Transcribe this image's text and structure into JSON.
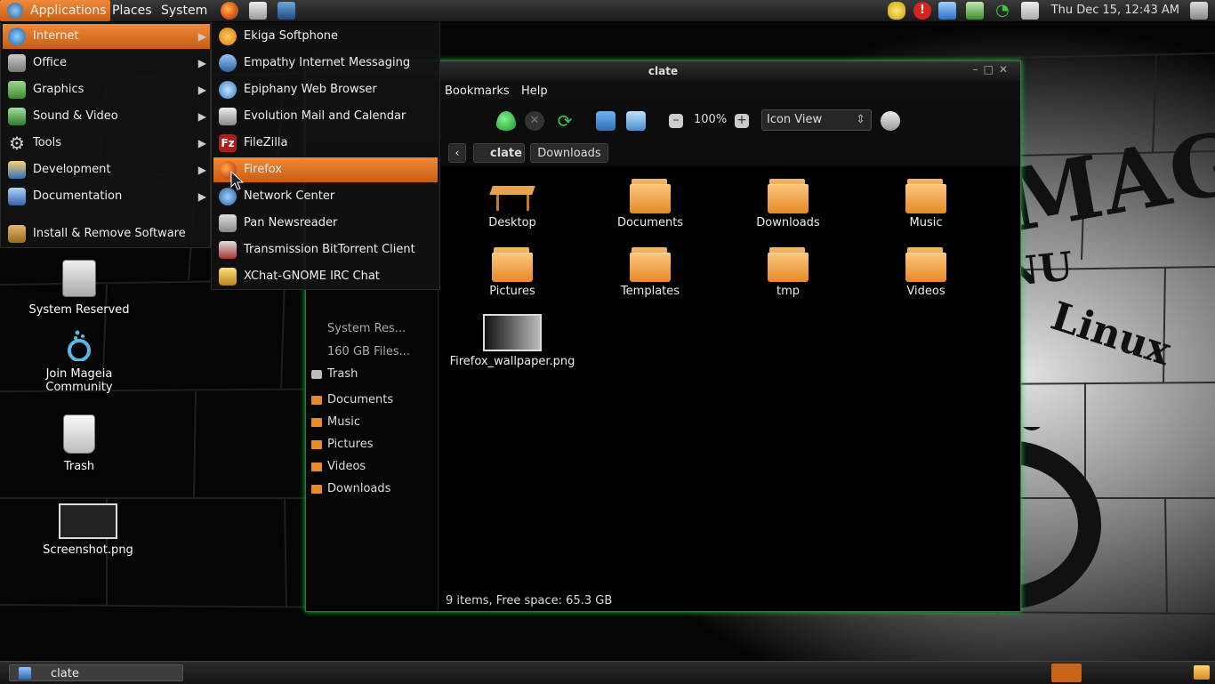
{
  "top_panel": {
    "menus": {
      "applications": "Applications",
      "places": "Places",
      "system": "System"
    },
    "clock": "Thu Dec 15, 12:43 AM",
    "launchers": [
      "firefox-icon",
      "mail-icon",
      "screenshot-icon"
    ],
    "tray": [
      "security-icon",
      "alert-icon",
      "update-icon",
      "network-manager-icon",
      "wifi-icon",
      "clipboard-icon"
    ]
  },
  "apps_menu": {
    "items": [
      {
        "label": "Internet",
        "icon": "globe-icon"
      },
      {
        "label": "Office",
        "icon": "office-icon"
      },
      {
        "label": "Graphics",
        "icon": "graphics-icon"
      },
      {
        "label": "Sound & Video",
        "icon": "music-icon"
      },
      {
        "label": "Tools",
        "icon": "gear-icon"
      },
      {
        "label": "Development",
        "icon": "development-icon"
      },
      {
        "label": "Documentation",
        "icon": "documentation-icon"
      },
      {
        "label": "Install & Remove Software",
        "icon": "package-icon"
      }
    ]
  },
  "internet_submenu": {
    "items": [
      {
        "label": "Ekiga Softphone",
        "icon": "ekiga-icon"
      },
      {
        "label": "Empathy Internet Messaging",
        "icon": "empathy-icon"
      },
      {
        "label": "Epiphany Web Browser",
        "icon": "epiphany-icon"
      },
      {
        "label": "Evolution Mail and Calendar",
        "icon": "evolution-icon"
      },
      {
        "label": "FileZilla",
        "icon": "filezilla-icon"
      },
      {
        "label": "Firefox",
        "icon": "firefox-icon"
      },
      {
        "label": "Network Center",
        "icon": "network-center-icon"
      },
      {
        "label": "Pan Newsreader",
        "icon": "pan-icon"
      },
      {
        "label": "Transmission BitTorrent Client",
        "icon": "transmission-icon"
      },
      {
        "label": "XChat-GNOME IRC Chat",
        "icon": "xchat-icon"
      }
    ],
    "highlighted": "Firefox"
  },
  "desktop": {
    "items": [
      {
        "label": "System Reserved"
      },
      {
        "label": "Join Mageia Community"
      },
      {
        "label": "Trash"
      },
      {
        "label": "Screenshot.png"
      }
    ]
  },
  "file_manager": {
    "title": "clate",
    "menubar": {
      "bookmarks": "Bookmarks",
      "help": "Help"
    },
    "zoom": "100%",
    "view_mode": "Icon View",
    "path": [
      "clate",
      "Downloads"
    ],
    "sidebar": {
      "devices": [
        "System Res...",
        "160 GB Files..."
      ],
      "trash": "Trash",
      "bookmarks": [
        "Documents",
        "Music",
        "Pictures",
        "Videos",
        "Downloads"
      ]
    },
    "files": [
      {
        "name": "Desktop",
        "type": "desktop"
      },
      {
        "name": "Documents",
        "type": "folder"
      },
      {
        "name": "Downloads",
        "type": "folder"
      },
      {
        "name": "Music",
        "type": "folder"
      },
      {
        "name": "Pictures",
        "type": "folder"
      },
      {
        "name": "Templates",
        "type": "folder"
      },
      {
        "name": "tmp",
        "type": "folder"
      },
      {
        "name": "Videos",
        "type": "folder"
      },
      {
        "name": "Firefox_wallpaper.png",
        "type": "image"
      }
    ],
    "status": "9 items, Free space: 65.3 GB"
  },
  "bottom_panel": {
    "task_label": "clate"
  },
  "wallpaper": {
    "text_main": "MAGEIA",
    "text_gnu": "GNU",
    "text_linux": "Linux"
  },
  "colors": {
    "accent": "#e0711f",
    "folder": "#e88a28",
    "window_border": "#3c6a5a"
  }
}
